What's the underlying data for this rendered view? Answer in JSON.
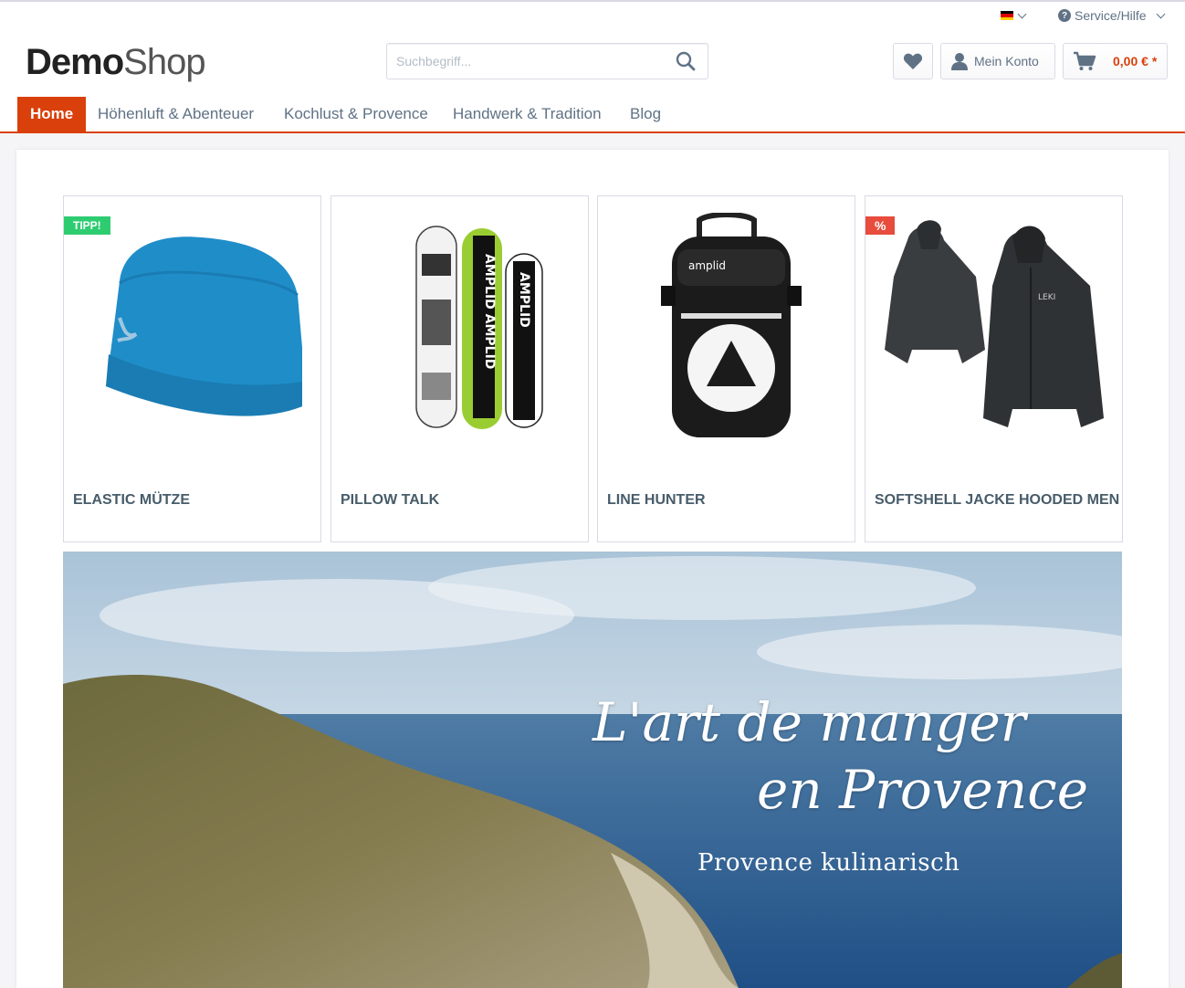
{
  "topbar": {
    "language_flag": "de-flag-icon",
    "service_label": "Service/Hilfe"
  },
  "logo": {
    "part1": "Demo",
    "part2": "Shop"
  },
  "search": {
    "placeholder": "Suchbegriff..."
  },
  "account": {
    "label": "Mein Konto"
  },
  "cart": {
    "amount": "0,00 € *"
  },
  "colors": {
    "accent": "#d9400b",
    "text": "#5f7285",
    "tip_badge": "#2ecc71",
    "sale_badge": "#e74c3c"
  },
  "nav": {
    "items": [
      {
        "label": "Home"
      },
      {
        "label": "Höhenluft & Abenteuer"
      },
      {
        "label": "Kochlust & Provence"
      },
      {
        "label": "Handwerk & Tradition"
      },
      {
        "label": "Blog"
      }
    ]
  },
  "products": [
    {
      "title": "Elastic Mütze",
      "badge": "TIPP!",
      "image_icon": "beanie-image"
    },
    {
      "title": "Pillow Talk",
      "badge": "",
      "image_icon": "snowboard-image"
    },
    {
      "title": "Line Hunter",
      "badge": "",
      "image_icon": "backpack-image"
    },
    {
      "title": "Softshell Jacke Hooded Men",
      "badge": "%",
      "image_icon": "jacket-image"
    }
  ],
  "banner": {
    "line1": "L'art de manger",
    "line2": "en Provence",
    "subtitle": "Provence kulinarisch"
  }
}
